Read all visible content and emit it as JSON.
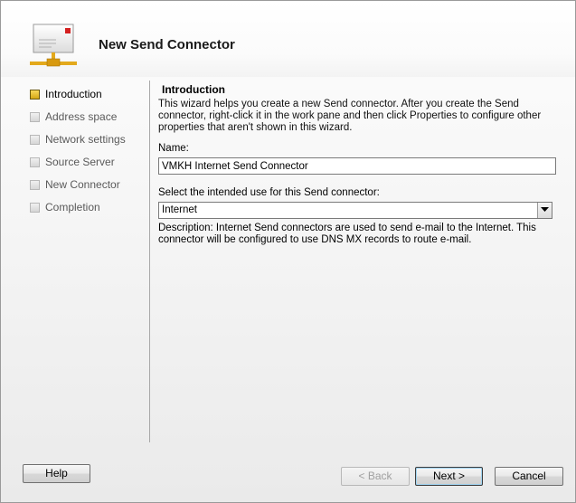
{
  "wizard": {
    "title": "New Send Connector"
  },
  "nav": {
    "items": [
      {
        "label": "Introduction",
        "active": true
      },
      {
        "label": "Address space",
        "active": false
      },
      {
        "label": "Network settings",
        "active": false
      },
      {
        "label": "Source Server",
        "active": false
      },
      {
        "label": "New Connector",
        "active": false
      },
      {
        "label": "Completion",
        "active": false
      }
    ]
  },
  "content": {
    "section_title": "Introduction",
    "intro": "This wizard helps you create a new Send connector. After you create the Send connector, right-click it in the work pane and then click Properties to configure other properties that aren't shown in this wizard.",
    "name_label": "Name:",
    "name_value": "VMKH Internet Send Connector",
    "use_label": "Select the intended use for this Send connector:",
    "use_value": "Internet",
    "description": "Description: Internet Send connectors are used to send e-mail to the Internet. This connector will be configured to use DNS MX records to route e-mail."
  },
  "buttons": {
    "help": "Help",
    "back": "< Back",
    "next": "Next >",
    "cancel": "Cancel"
  }
}
